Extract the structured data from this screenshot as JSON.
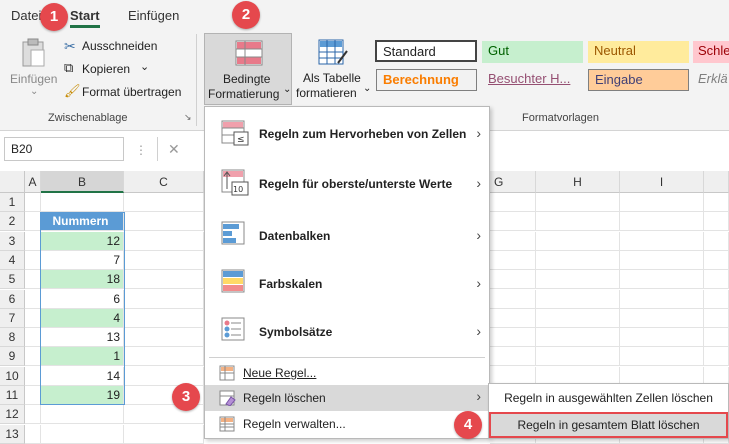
{
  "tabs": [
    {
      "label": "Datei"
    },
    {
      "label": "Start"
    },
    {
      "label": "Einfügen"
    }
  ],
  "badges": [
    "1",
    "2",
    "3",
    "4"
  ],
  "clipboard": {
    "paste": "Einfügen",
    "cut": "Ausschneiden",
    "copy": "Kopieren",
    "format_painter": "Format übertragen",
    "group": "Zwischenablage"
  },
  "cond_format": {
    "line1": "Bedingte",
    "line2": "Formatierung"
  },
  "as_table": {
    "line1": "Als Tabelle",
    "line2": "formatieren"
  },
  "styles": {
    "group": "Formatvorlagen",
    "items": [
      "Standard",
      "Gut",
      "Neutral",
      "Schle",
      "Berechnung",
      "Besuchter H...",
      "Eingabe",
      "Erklä"
    ]
  },
  "namebox": "B20",
  "fx_cancel": "✕",
  "columns": [
    "A",
    "B",
    "C",
    "G",
    "H",
    "I"
  ],
  "rows": [
    "1",
    "2",
    "3",
    "4",
    "5",
    "6",
    "7",
    "8",
    "9",
    "10",
    "11",
    "12",
    "13"
  ],
  "header_cell": "Nummern",
  "values": [
    "12",
    "7",
    "18",
    "6",
    "4",
    "13",
    "1",
    "14",
    "19"
  ],
  "menu": {
    "items": [
      "Regeln zum Hervorheben von Zellen",
      "Regeln für oberste/unterste Werte",
      "Datenbalken",
      "Farbskalen",
      "Symbolsätze",
      "Neue Regel...",
      "Regeln löschen",
      "Regeln verwalten..."
    ]
  },
  "submenu": {
    "items": [
      "Regeln in ausgewählten Zellen löschen",
      "Regeln in gesamtem Blatt löschen"
    ]
  },
  "colors": {
    "accent": "#217346",
    "badge": "#e5484d",
    "table_header": "#5b9bd5",
    "highlight": "#c6efce"
  }
}
